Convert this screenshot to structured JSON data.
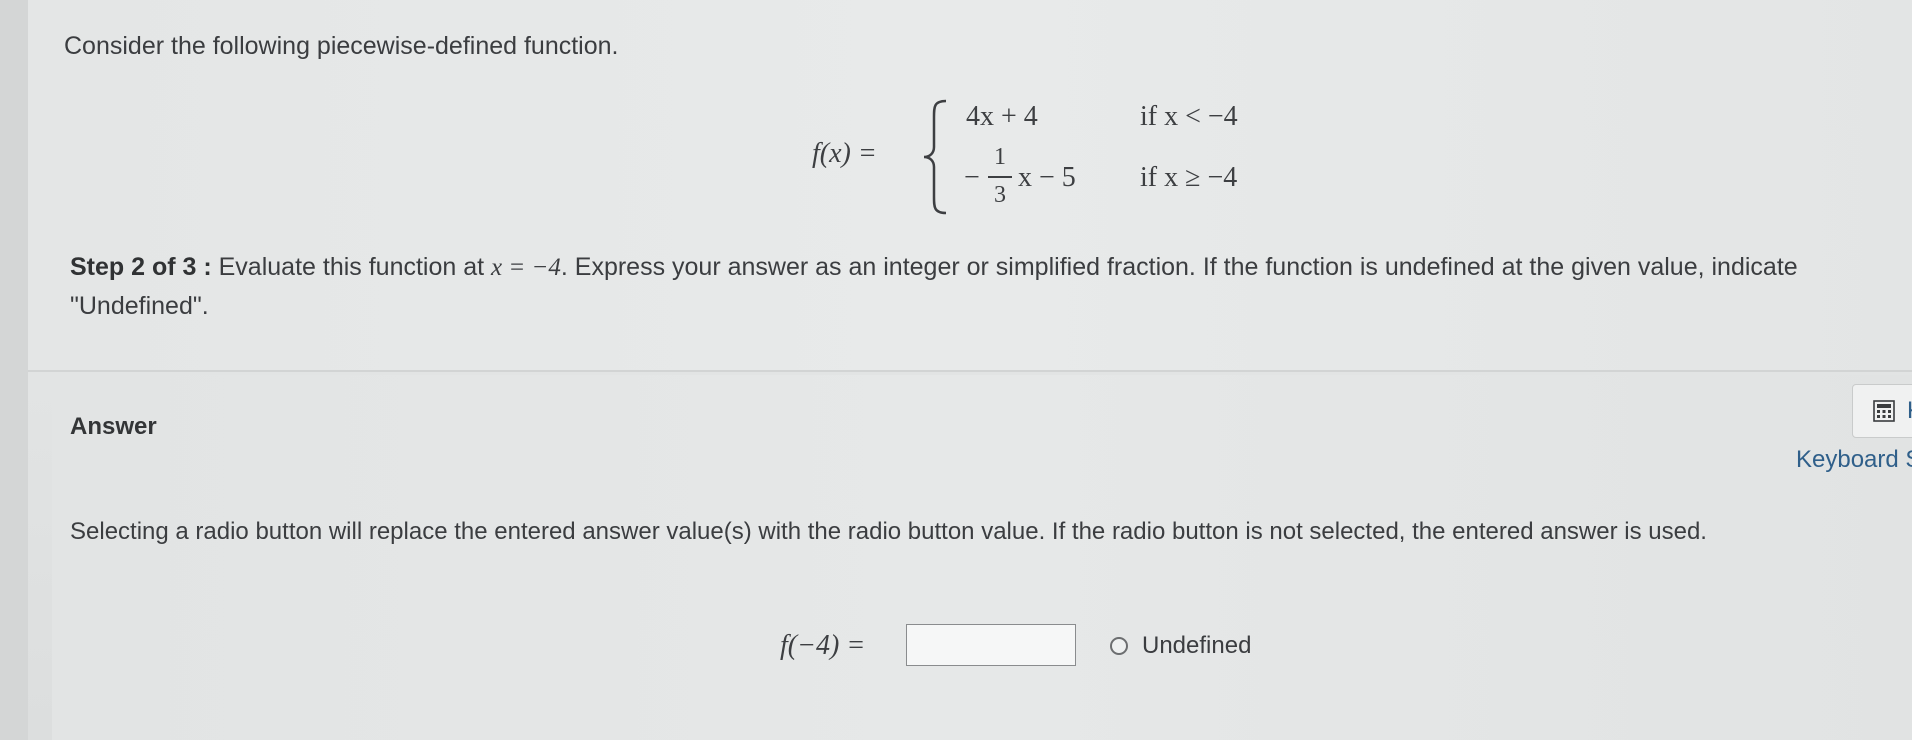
{
  "question": {
    "intro": "Consider the following piecewise-defined function.",
    "function_name": "f(x) =",
    "pieces": [
      {
        "expression": "4x + 4",
        "condition": "if x < −4"
      },
      {
        "expression_prefix": "−",
        "frac_num": "1",
        "frac_den": "3",
        "expression_suffix": "x − 5",
        "condition": "if x ≥ −4"
      }
    ],
    "step_label": "Step 2 of 3 :",
    "step_text_a": " Evaluate this function at ",
    "step_math": "x = −4",
    "step_text_b": ". Express your answer as an integer or simplified fraction. If the function is undefined at the given value, indicate \"Undefined\"."
  },
  "answer": {
    "label": "Answer",
    "keyboard_button_text": "Ke",
    "keyboard_shortcuts_text": "Keyboard Sh",
    "radio_note": "Selecting a radio button will replace the entered answer value(s) with the radio button value. If the radio button is not selected, the entered answer is used.",
    "eval_label": "f(−4) =",
    "input_value": "",
    "radio_label": "Undefined"
  },
  "colors": {
    "link": "#2f5f8a",
    "text": "#3b3d40"
  }
}
